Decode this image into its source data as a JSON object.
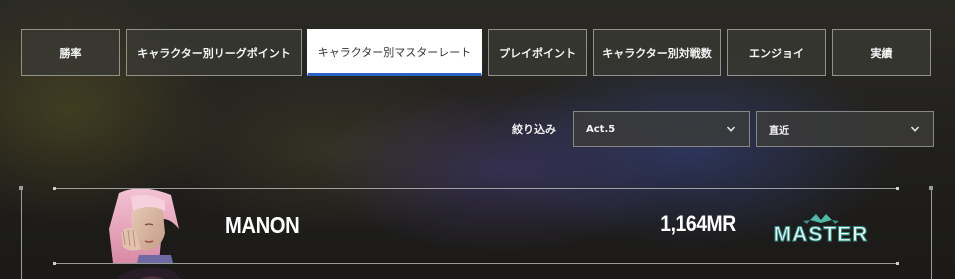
{
  "tabs": [
    {
      "label": "勝率",
      "active": false
    },
    {
      "label": "キャラクター別リーグポイント",
      "active": false
    },
    {
      "label": "キャラクター別マスターレート",
      "active": true
    },
    {
      "label": "プレイポイント",
      "active": false
    },
    {
      "label": "キャラクター別対戦数",
      "active": false
    },
    {
      "label": "エンジョイ",
      "active": false
    },
    {
      "label": "実績",
      "active": false
    }
  ],
  "filter": {
    "label": "絞り込み",
    "season_value": "Act.5",
    "period_value": "直近"
  },
  "ranking": {
    "character_name": "MANON",
    "master_rate": "1,164MR",
    "rank": "MASTER"
  },
  "colors": {
    "active_tab_underline": "#2a62c9",
    "rank_badge_text": "#e9f4f4",
    "rank_badge_accent": "#4fb8a8"
  },
  "icons": {
    "select_arrow": "chevron-down-icon",
    "rank_emblem": "master-rank-badge"
  }
}
